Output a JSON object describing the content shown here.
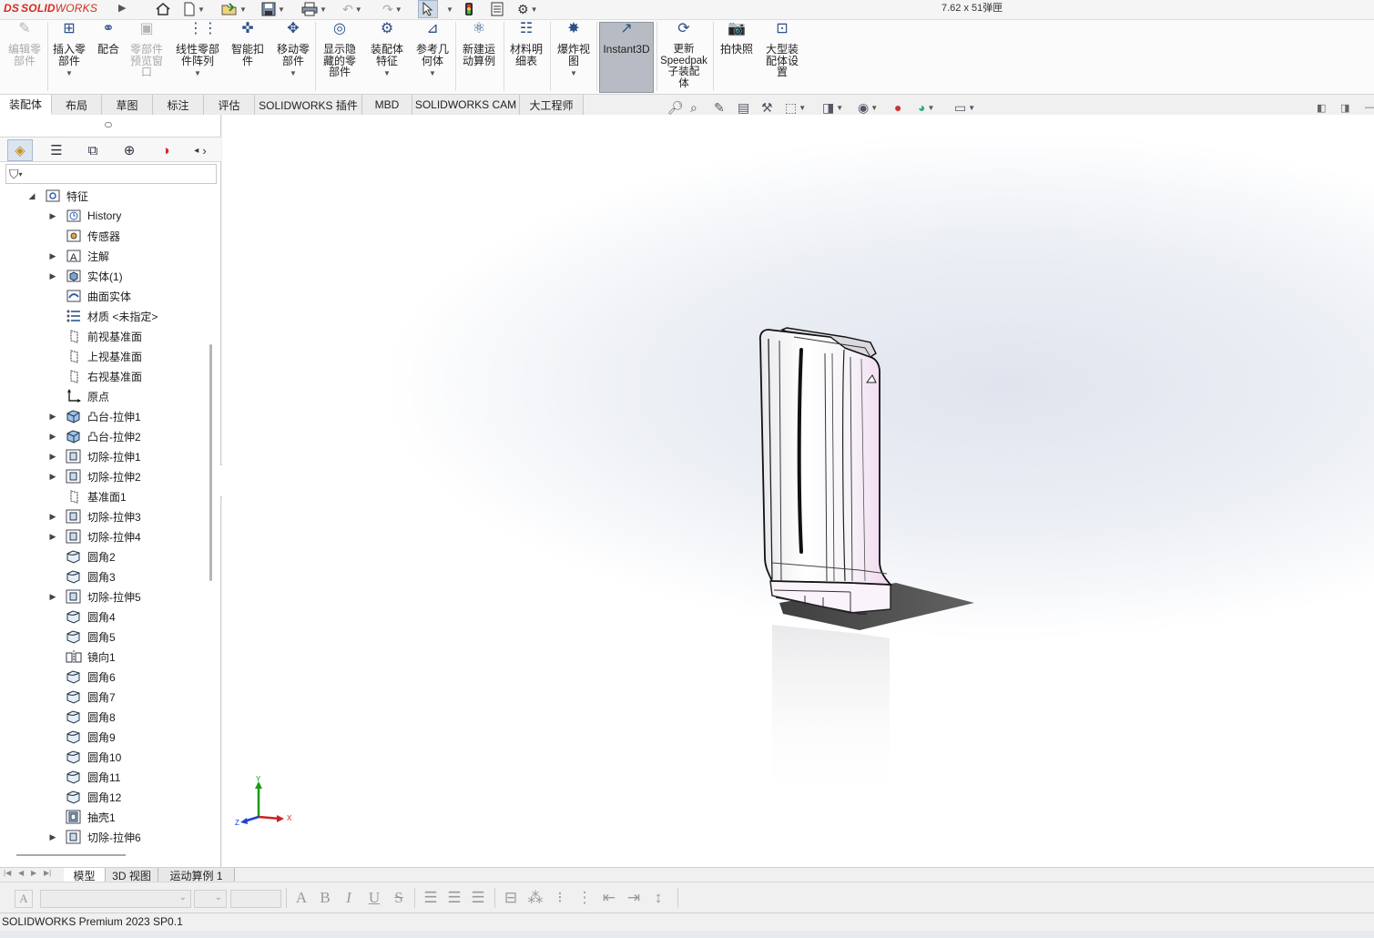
{
  "titlebar": {
    "brand_prefix": "DS",
    "brand_solid": "SOLID",
    "brand_works": "WORKS",
    "document_info": "7.62 x 51弹匣"
  },
  "ribbon": {
    "buttons": [
      {
        "label": "编辑零\n部件",
        "icon": "edit-component-icon",
        "enabled": false
      },
      {
        "label": "插入零\n部件",
        "icon": "insert-component-icon",
        "enabled": true
      },
      {
        "label": "配合",
        "icon": "mate-icon",
        "enabled": true
      },
      {
        "label": "零部件\n预览窗\n口",
        "icon": "component-preview-icon",
        "enabled": false
      },
      {
        "label": "线性零部\n件阵列",
        "icon": "linear-pattern-icon",
        "enabled": true
      },
      {
        "label": "智能扣\n件",
        "icon": "smart-fastener-icon",
        "enabled": true
      },
      {
        "label": "移动零\n部件",
        "icon": "move-component-icon",
        "enabled": true
      },
      {
        "label": "显示隐\n藏的零\n部件",
        "icon": "show-hidden-icon",
        "enabled": true
      },
      {
        "label": "装配体\n特征",
        "icon": "assembly-feature-icon",
        "enabled": true
      },
      {
        "label": "参考几\n何体",
        "icon": "reference-geometry-icon",
        "enabled": true
      },
      {
        "label": "新建运\n动算例",
        "icon": "motion-study-icon",
        "enabled": true
      },
      {
        "label": "材料明\n细表",
        "icon": "bom-icon",
        "enabled": true
      },
      {
        "label": "爆炸视\n图",
        "icon": "exploded-view-icon",
        "enabled": true
      },
      {
        "label": "Instant3D",
        "icon": "instant3d-icon",
        "enabled": true
      },
      {
        "label": "更新\nSpeedpak\n子装配\n体",
        "icon": "speedpak-icon",
        "enabled": true
      },
      {
        "label": "拍快照",
        "icon": "snapshot-icon",
        "enabled": true
      },
      {
        "label": "大型装\n配体设\n置",
        "icon": "large-assembly-icon",
        "enabled": true
      }
    ]
  },
  "command_tabs": [
    "装配体",
    "布局",
    "草图",
    "标注",
    "评估",
    "SOLIDWORKS 插件",
    "MBD",
    "SOLIDWORKS CAM",
    "大工程师"
  ],
  "tree": {
    "root": "特征",
    "items": [
      {
        "label": "History",
        "icon": "history-folder-icon",
        "expand": true
      },
      {
        "label": "传感器",
        "icon": "sensor-folder-icon",
        "expand": false
      },
      {
        "label": "注解",
        "icon": "annotation-folder-icon",
        "expand": true
      },
      {
        "label": "实体(1)",
        "icon": "solid-bodies-icon",
        "expand": true
      },
      {
        "label": "曲面实体",
        "icon": "surface-bodies-icon",
        "expand": false
      },
      {
        "label": "材质 <未指定>",
        "icon": "material-icon",
        "expand": false
      },
      {
        "label": "前视基准面",
        "icon": "plane-icon",
        "expand": false
      },
      {
        "label": "上视基准面",
        "icon": "plane-icon",
        "expand": false
      },
      {
        "label": "右视基准面",
        "icon": "plane-icon",
        "expand": false
      },
      {
        "label": "原点",
        "icon": "origin-icon",
        "expand": false
      },
      {
        "label": "凸台-拉伸1",
        "icon": "boss-extrude-icon",
        "expand": true
      },
      {
        "label": "凸台-拉伸2",
        "icon": "boss-extrude-icon",
        "expand": true
      },
      {
        "label": "切除-拉伸1",
        "icon": "cut-extrude-icon",
        "expand": true
      },
      {
        "label": "切除-拉伸2",
        "icon": "cut-extrude-icon",
        "expand": true
      },
      {
        "label": "基准面1",
        "icon": "plane-icon",
        "expand": false
      },
      {
        "label": "切除-拉伸3",
        "icon": "cut-extrude-icon",
        "expand": true
      },
      {
        "label": "切除-拉伸4",
        "icon": "cut-extrude-icon",
        "expand": true
      },
      {
        "label": "圆角2",
        "icon": "fillet-icon",
        "expand": false
      },
      {
        "label": "圆角3",
        "icon": "fillet-icon",
        "expand": false
      },
      {
        "label": "切除-拉伸5",
        "icon": "cut-extrude-icon",
        "expand": true
      },
      {
        "label": "圆角4",
        "icon": "fillet-icon",
        "expand": false
      },
      {
        "label": "圆角5",
        "icon": "fillet-icon",
        "expand": false
      },
      {
        "label": "镜向1",
        "icon": "mirror-icon",
        "expand": false
      },
      {
        "label": "圆角6",
        "icon": "fillet-icon",
        "expand": false
      },
      {
        "label": "圆角7",
        "icon": "fillet-icon",
        "expand": false
      },
      {
        "label": "圆角8",
        "icon": "fillet-icon",
        "expand": false
      },
      {
        "label": "圆角9",
        "icon": "fillet-icon",
        "expand": false
      },
      {
        "label": "圆角10",
        "icon": "fillet-icon",
        "expand": false
      },
      {
        "label": "圆角11",
        "icon": "fillet-icon",
        "expand": false
      },
      {
        "label": "圆角12",
        "icon": "fillet-icon",
        "expand": false
      },
      {
        "label": "抽壳1",
        "icon": "shell-icon",
        "expand": false
      },
      {
        "label": "切除-拉伸6",
        "icon": "cut-extrude-icon",
        "expand": true
      }
    ]
  },
  "triad": {
    "x": "X",
    "y": "Y",
    "z": "Z"
  },
  "bottom_tabs": [
    "模型",
    "3D 视图",
    "运动算例 1"
  ],
  "format_toolbar": {
    "font_field_value": "",
    "size_field_value": "",
    "buttons": [
      "A",
      "B",
      "I",
      "U",
      "S"
    ]
  },
  "status": {
    "text": "SOLIDWORKS Premium 2023 SP0.1"
  },
  "colors": {
    "brand": "#d52b1e",
    "model_body": "#f7f6f8",
    "model_tint": "#f2d5ee",
    "shadow": "#3a3a3a"
  }
}
